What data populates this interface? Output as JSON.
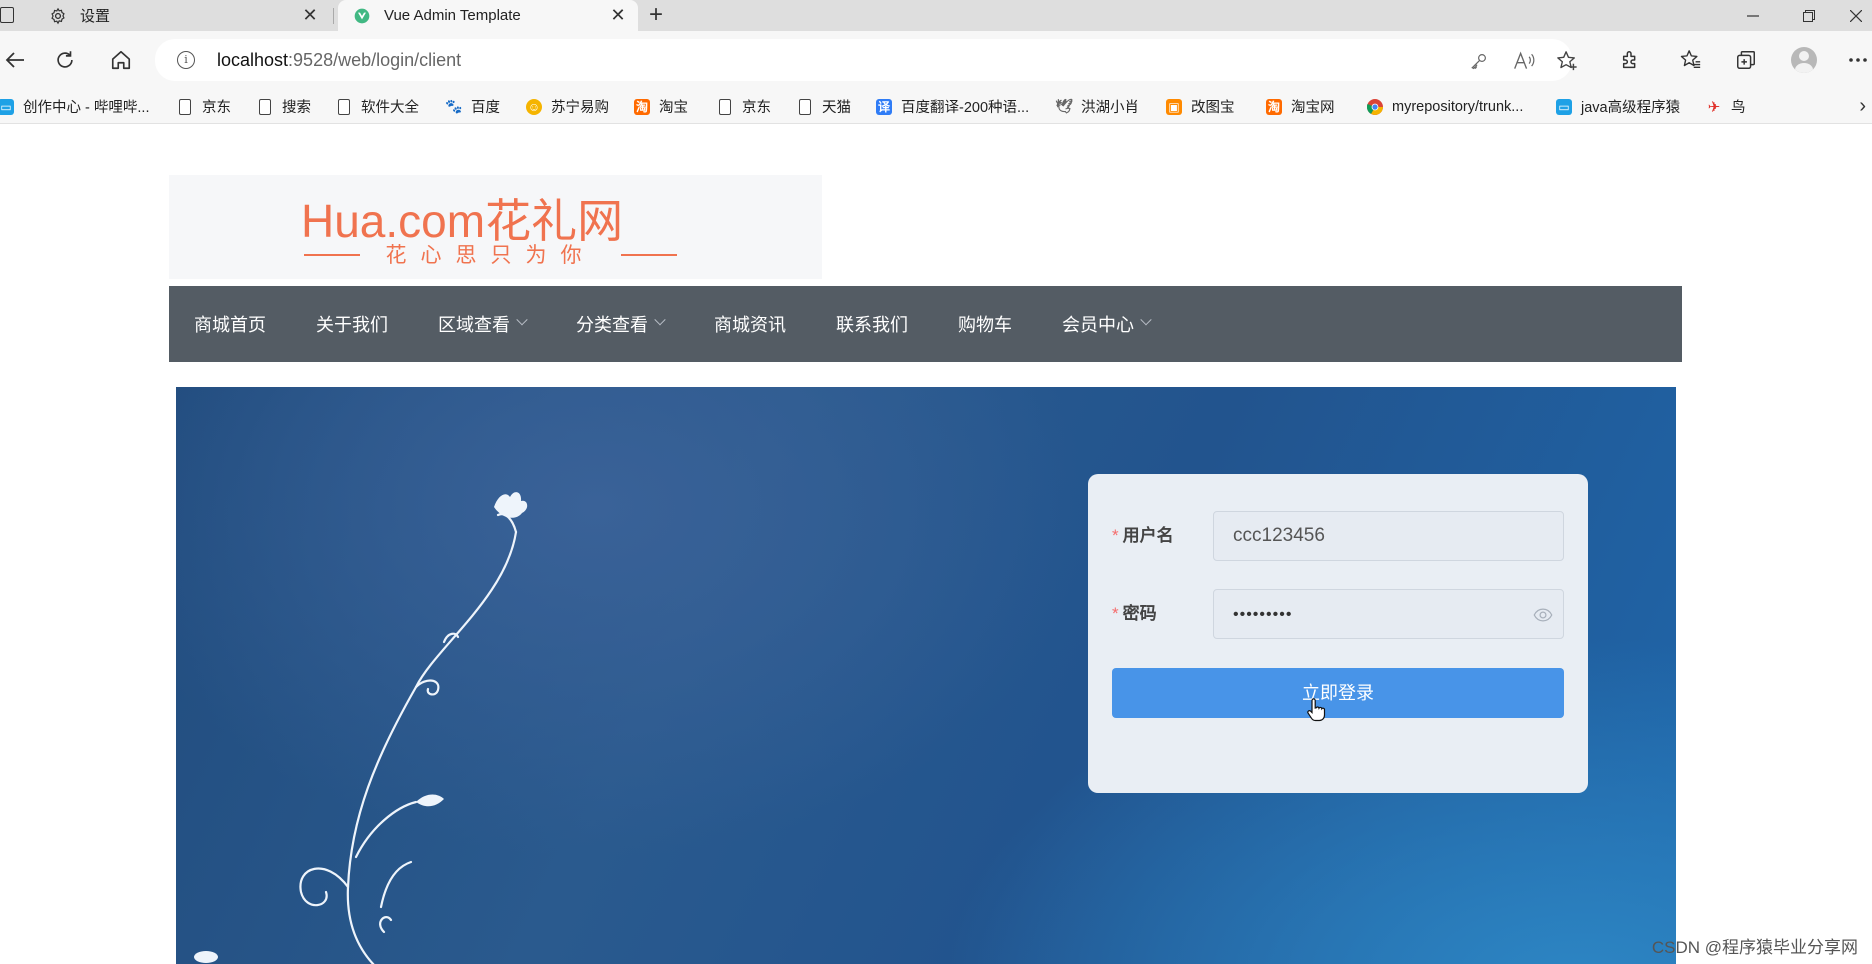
{
  "browser": {
    "tabs": [
      {
        "title": "设置",
        "icon": "gear-icon",
        "active": false
      },
      {
        "title": "Vue Admin Template",
        "icon": "vue-logo-icon",
        "active": true
      }
    ],
    "address": {
      "host": "localhost",
      "path": ":9528/web/login/client"
    },
    "bookmarks": [
      {
        "label": "创作中心 - 哔哩哔...",
        "icon": "bilibili-icon",
        "color": "#1ea1e6"
      },
      {
        "label": "京东",
        "icon": "page-icon"
      },
      {
        "label": "搜索",
        "icon": "page-icon"
      },
      {
        "label": "软件大全",
        "icon": "page-icon"
      },
      {
        "label": "百度",
        "icon": "baidu-paw-icon",
        "color": "#2e5bd8"
      },
      {
        "label": "苏宁易购",
        "icon": "suning-icon",
        "color": "#f5b400"
      },
      {
        "label": "淘宝",
        "icon": "taobao-icon",
        "color": "#ff6a00"
      },
      {
        "label": "京东",
        "icon": "page-icon"
      },
      {
        "label": "天猫",
        "icon": "page-icon"
      },
      {
        "label": "百度翻译-200种语...",
        "icon": "translate-icon",
        "color": "#2f7cf6"
      },
      {
        "label": "洪湖小肖",
        "icon": "bird-icon",
        "color": "#666666"
      },
      {
        "label": "改图宝",
        "icon": "gaitubao-icon",
        "color": "#ff8a00"
      },
      {
        "label": "淘宝网",
        "icon": "taobao-icon",
        "color": "#ff6a00"
      },
      {
        "label": "myrepository/trunk...",
        "icon": "chrome-icon",
        "color": "#db4437"
      },
      {
        "label": "java高级程序猿",
        "icon": "bilibili-icon",
        "color": "#1ea1e6"
      },
      {
        "label": "鸟",
        "icon": "red-bird-icon",
        "color": "#e0312a"
      }
    ]
  },
  "site": {
    "logo": {
      "brand": "Hua.com花礼网",
      "slogan": "花心思只为你"
    },
    "nav": [
      {
        "label": "商城首页",
        "dropdown": false
      },
      {
        "label": "关于我们",
        "dropdown": false
      },
      {
        "label": "区域查看",
        "dropdown": true
      },
      {
        "label": "分类查看",
        "dropdown": true
      },
      {
        "label": "商城资讯",
        "dropdown": false
      },
      {
        "label": "联系我们",
        "dropdown": false
      },
      {
        "label": "购物车",
        "dropdown": false
      },
      {
        "label": "会员中心",
        "dropdown": true
      }
    ],
    "login": {
      "username_label": "用户名",
      "username_value": "ccc123456",
      "password_label": "密码",
      "password_mask": "•••••••••",
      "submit_label": "立即登录"
    }
  },
  "watermark": "CSDN @程序猿毕业分享网",
  "colors": {
    "navbar": "#545c64",
    "brand": "#f0734f",
    "primary_button": "#4894e8",
    "required_star": "#f56c6c"
  }
}
